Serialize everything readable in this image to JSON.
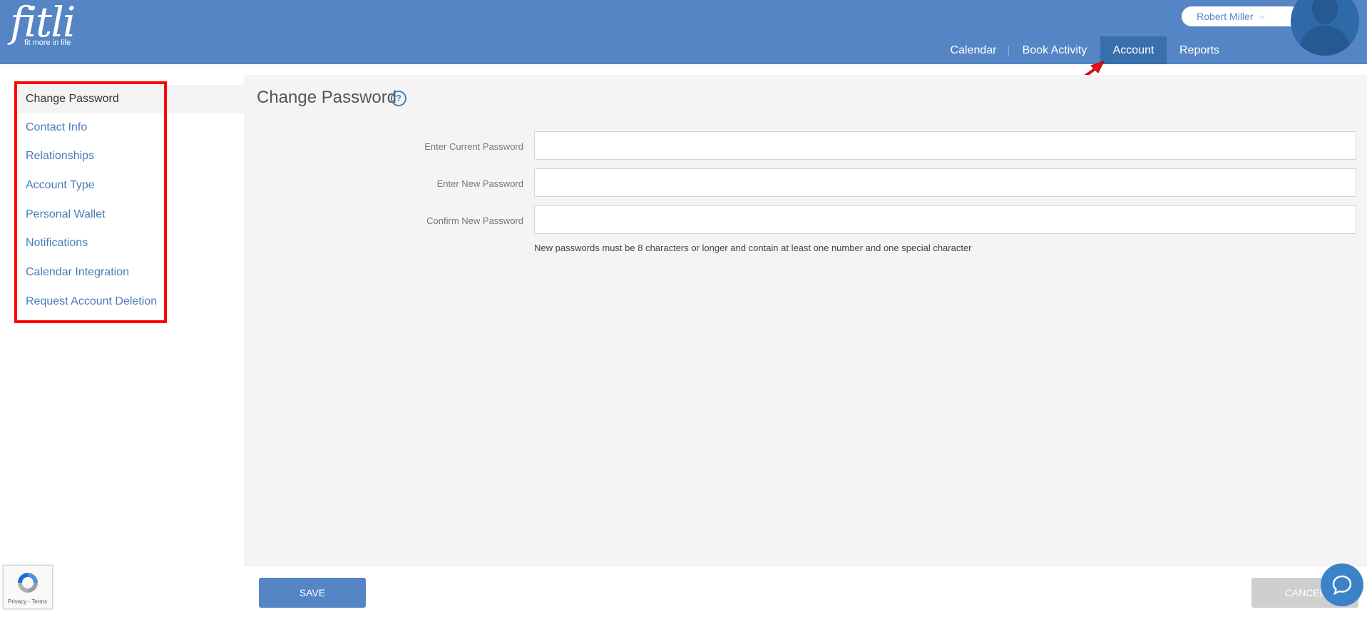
{
  "header": {
    "logo_text": "fitli",
    "logo_tagline": "fit more in life",
    "user_name": "Robert Miller",
    "nav": [
      "Calendar",
      "Book Activity",
      "Account",
      "Reports"
    ],
    "active_nav": "Account",
    "brand_color": "#5585c4"
  },
  "sidebar": {
    "items": [
      "Change Password",
      "Contact Info",
      "Relationships",
      "Account Type",
      "Personal Wallet",
      "Notifications",
      "Calendar Integration",
      "Request Account Deletion"
    ],
    "active": "Change Password"
  },
  "main": {
    "title": "Change Password",
    "fields": [
      {
        "label": "Enter Current Password",
        "value": ""
      },
      {
        "label": "Enter New Password",
        "value": ""
      },
      {
        "label": "Confirm New Password",
        "value": ""
      }
    ],
    "hint": "New passwords must be 8 characters or longer and contain at least one number and one special character"
  },
  "footer": {
    "save_label": "SAVE",
    "cancel_label": "CANCEL"
  },
  "recaptcha": {
    "links": "Privacy - Terms"
  },
  "icons": {
    "help": "question-circle-icon",
    "chat": "chat-bubble-icon",
    "chevron": "chevron-down-icon",
    "avatar": "user-silhouette-icon"
  }
}
